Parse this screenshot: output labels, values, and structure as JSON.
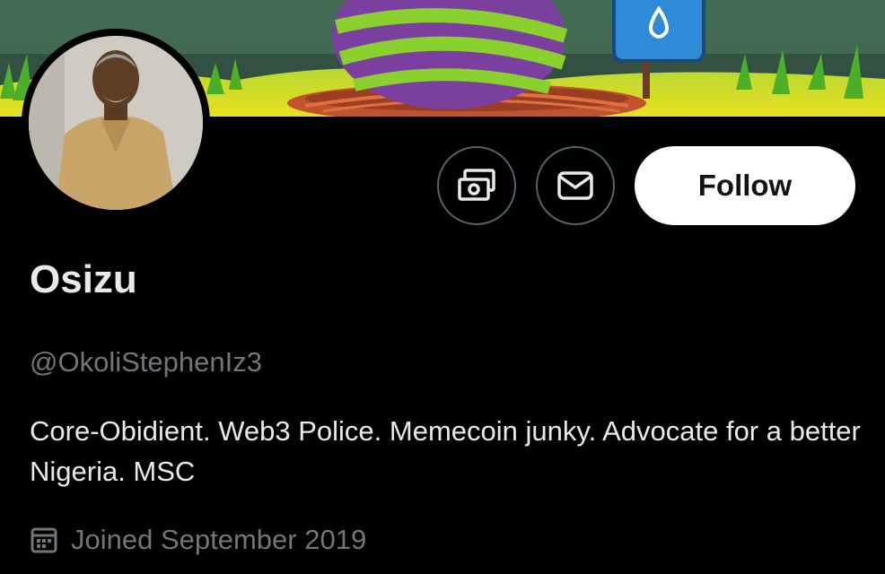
{
  "profile": {
    "display_name": "Osizu",
    "handle": "@OkoliStephenIz3",
    "bio": "Core-Obidient. Web3 Police. Memecoin junky. Advocate for a better Nigeria. MSC",
    "joined": "Joined September 2019"
  },
  "actions": {
    "follow_label": "Follow"
  },
  "icons": {
    "tip": "money-icon",
    "message": "envelope-icon",
    "joined": "calendar-icon"
  },
  "colors": {
    "background": "#000000",
    "primary_text": "#e7e9ea",
    "secondary_text": "#71767b",
    "button_border": "#536471",
    "follow_bg": "#ffffff",
    "follow_text": "#0f1419"
  }
}
